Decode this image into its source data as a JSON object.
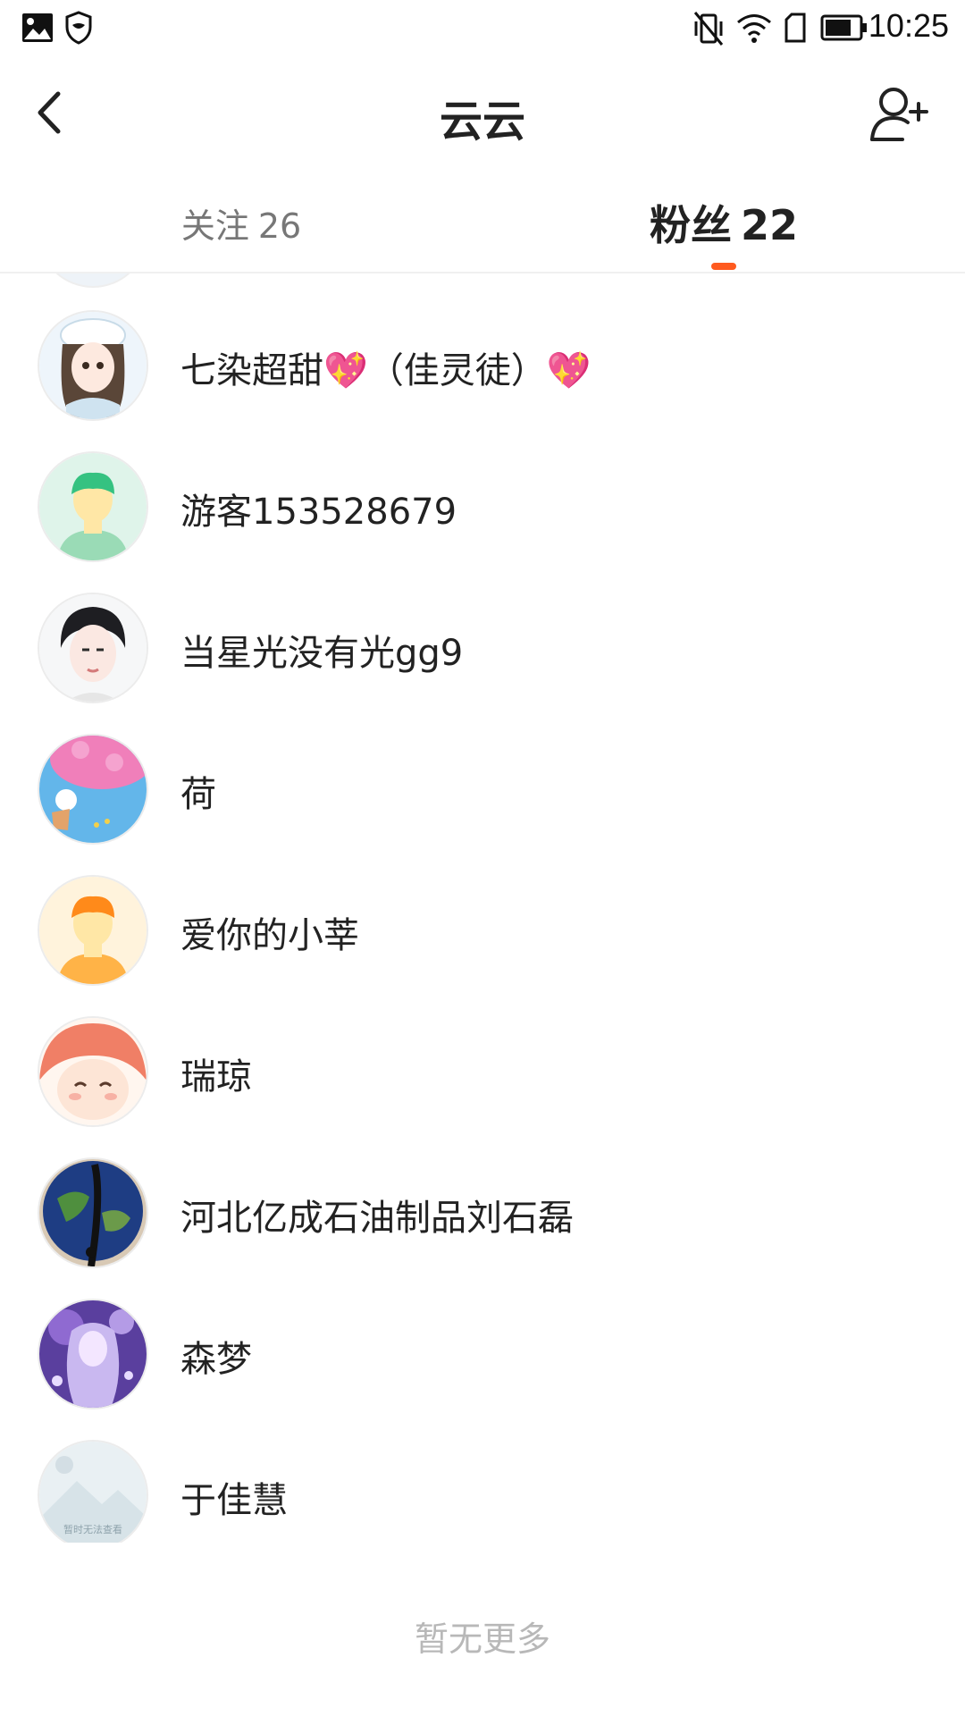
{
  "status_bar": {
    "time": "10:25"
  },
  "header": {
    "title": "云云"
  },
  "tabs": [
    {
      "label": "关注",
      "count": "26"
    },
    {
      "label": "粉丝",
      "count": "22"
    }
  ],
  "accent_color": "#ff5a1f",
  "fans": [
    {
      "name": "七染超甜",
      "heart": "💖",
      "suffix": "（佳灵徒）",
      "heart2": "💖"
    },
    {
      "name": "游客153528679"
    },
    {
      "name": "当星光没有光gg9"
    },
    {
      "name": "荷"
    },
    {
      "name": "爱你的小莘"
    },
    {
      "name": "瑞琼"
    },
    {
      "name": "河北亿成石油制品刘石磊"
    },
    {
      "name": "森梦"
    },
    {
      "name": "于佳慧"
    }
  ],
  "footer": {
    "no_more": "暂无更多"
  },
  "avatar_placeholder_text": "暂时无法查看"
}
